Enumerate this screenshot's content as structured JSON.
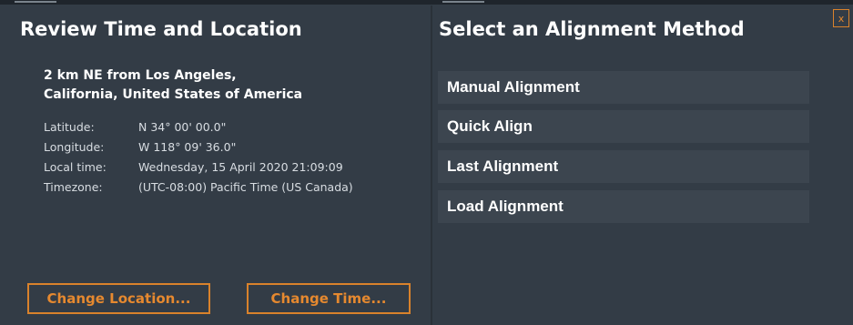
{
  "review": {
    "title": "Review Time and Location",
    "location_line1": "2 km NE from Los Angeles,",
    "location_line2": "California, United States of America",
    "fields": [
      {
        "label": "Latitude:",
        "value": "N 34° 00' 00.0\""
      },
      {
        "label": "Longitude:",
        "value": "W 118° 09' 36.0\""
      },
      {
        "label": "Local time:",
        "value": "Wednesday, 15 April 2020 21:09:09"
      },
      {
        "label": "Timezone:",
        "value": "(UTC-08:00) Pacific Time (US  Canada)"
      }
    ],
    "change_location_label": "Change Location...",
    "change_time_label": "Change Time..."
  },
  "alignment": {
    "title": "Select an Alignment Method",
    "methods": [
      {
        "label": "Manual Alignment"
      },
      {
        "label": "Quick Align"
      },
      {
        "label": "Last Alignment"
      },
      {
        "label": "Load Alignment"
      }
    ],
    "close_label": "x"
  },
  "colors": {
    "background": "#333c46",
    "accent": "#e6892f",
    "button_fill": "#3c454f"
  }
}
